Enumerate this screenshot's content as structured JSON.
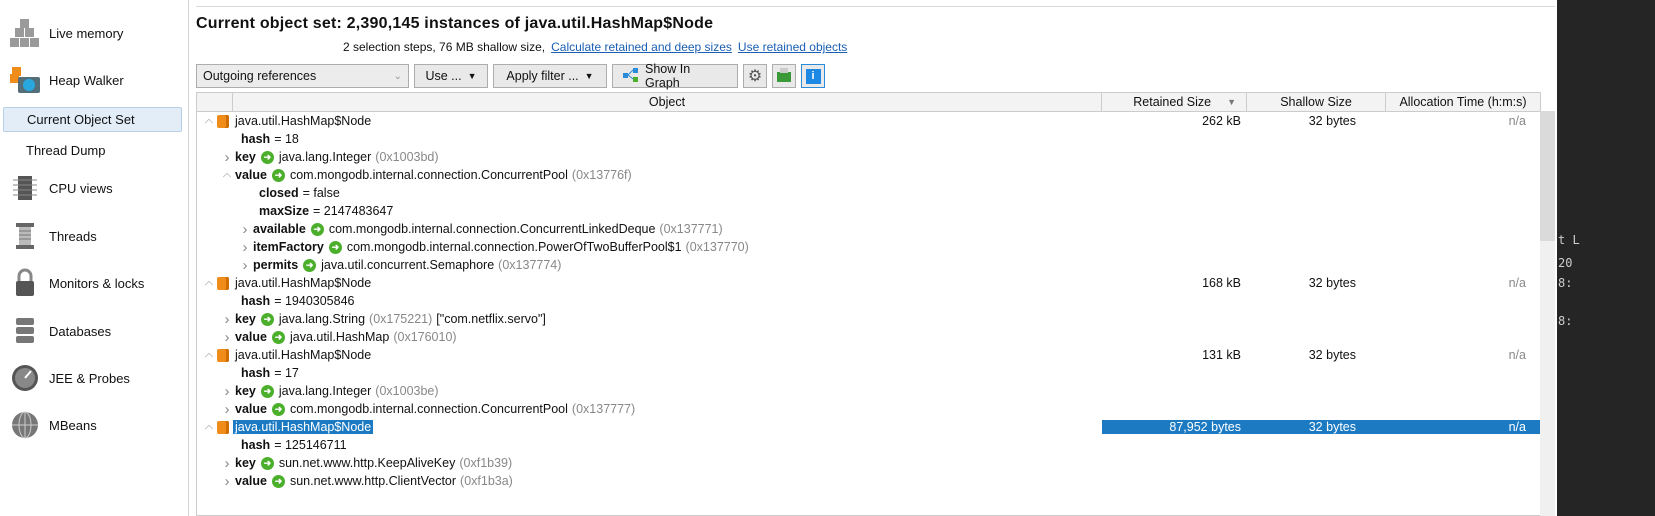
{
  "sidebar": {
    "items": [
      {
        "label": "Live memory",
        "icon": "live-memory-icon"
      },
      {
        "label": "Heap Walker",
        "icon": "heap-walker-icon"
      },
      {
        "label": "CPU views",
        "icon": "cpu-icon"
      },
      {
        "label": "Threads",
        "icon": "threads-icon"
      },
      {
        "label": "Monitors & locks",
        "icon": "lock-icon"
      },
      {
        "label": "Databases",
        "icon": "database-icon"
      },
      {
        "label": "JEE & Probes",
        "icon": "gauge-icon"
      },
      {
        "label": "MBeans",
        "icon": "globe-icon"
      }
    ],
    "subitems": [
      {
        "label": "Current Object Set",
        "selected": true
      },
      {
        "label": "Thread Dump",
        "selected": false
      }
    ]
  },
  "header": {
    "title": "Current object set:  2,390,145 instances of java.util.HashMap$Node",
    "summary": "2 selection steps, 76 MB shallow size,",
    "link_retained": "Calculate retained and deep sizes",
    "link_use_retained": "Use retained objects"
  },
  "toolbar": {
    "view": "Outgoing references",
    "use": "Use ...",
    "filter": "Apply filter ...",
    "graph": "Show In Graph"
  },
  "table": {
    "columns": [
      "Object",
      "Retained Size",
      "Shallow Size",
      "Allocation Time (h:m:s)"
    ],
    "sort_column": "Retained Size",
    "rows": [
      {
        "level": 0,
        "toggle": "open",
        "type": "node",
        "text": "java.util.HashMap$Node",
        "retained": "262 kB",
        "shallow": "32 bytes",
        "alloc": "n/a"
      },
      {
        "level": 1,
        "toggle": "none",
        "type": "field",
        "name": "hash",
        "value": "= 18"
      },
      {
        "level": 1,
        "toggle": "closed",
        "type": "ref",
        "name": "key",
        "text": "java.lang.Integer",
        "addr": "(0x1003bd)"
      },
      {
        "level": 1,
        "toggle": "open",
        "type": "ref",
        "name": "value",
        "text": "com.mongodb.internal.connection.ConcurrentPool",
        "addr": "(0x13776f)"
      },
      {
        "level": 2,
        "toggle": "none",
        "type": "field",
        "name": "closed",
        "value": "= false"
      },
      {
        "level": 2,
        "toggle": "none",
        "type": "field",
        "name": "maxSize",
        "value": "= 2147483647"
      },
      {
        "level": 2,
        "toggle": "closed",
        "type": "ref",
        "name": "available",
        "text": "com.mongodb.internal.connection.ConcurrentLinkedDeque",
        "addr": "(0x137771)"
      },
      {
        "level": 2,
        "toggle": "closed",
        "type": "ref",
        "name": "itemFactory",
        "text": "com.mongodb.internal.connection.PowerOfTwoBufferPool$1",
        "addr": "(0x137770)"
      },
      {
        "level": 2,
        "toggle": "closed",
        "type": "ref",
        "name": "permits",
        "text": "java.util.concurrent.Semaphore",
        "addr": "(0x137774)"
      },
      {
        "level": 0,
        "toggle": "open",
        "type": "node",
        "text": "java.util.HashMap$Node",
        "retained": "168 kB",
        "shallow": "32 bytes",
        "alloc": "n/a"
      },
      {
        "level": 1,
        "toggle": "none",
        "type": "field",
        "name": "hash",
        "value": "= 1940305846"
      },
      {
        "level": 1,
        "toggle": "closed",
        "type": "ref",
        "name": "key",
        "text": "java.lang.String",
        "addr": "(0x175221)",
        "extra": "[\"com.netflix.servo\"]"
      },
      {
        "level": 1,
        "toggle": "closed",
        "type": "ref",
        "name": "value",
        "text": "java.util.HashMap",
        "addr": "(0x176010)"
      },
      {
        "level": 0,
        "toggle": "open",
        "type": "node",
        "text": "java.util.HashMap$Node",
        "retained": "131 kB",
        "shallow": "32 bytes",
        "alloc": "n/a"
      },
      {
        "level": 1,
        "toggle": "none",
        "type": "field",
        "name": "hash",
        "value": "= 17"
      },
      {
        "level": 1,
        "toggle": "closed",
        "type": "ref",
        "name": "key",
        "text": "java.lang.Integer",
        "addr": "(0x1003be)"
      },
      {
        "level": 1,
        "toggle": "closed",
        "type": "ref",
        "name": "value",
        "text": "com.mongodb.internal.connection.ConcurrentPool",
        "addr": "(0x137777)"
      },
      {
        "level": 0,
        "toggle": "open",
        "type": "node",
        "text": "java.util.HashMap$Node",
        "retained": "87,952 bytes",
        "shallow": "32 bytes",
        "alloc": "n/a",
        "selected": true
      },
      {
        "level": 1,
        "toggle": "none",
        "type": "field",
        "name": "hash",
        "value": "= 125146711"
      },
      {
        "level": 1,
        "toggle": "closed",
        "type": "ref",
        "name": "key",
        "text": "sun.net.www.http.KeepAliveKey",
        "addr": "(0xf1b39)"
      },
      {
        "level": 1,
        "toggle": "closed",
        "type": "ref",
        "name": "value",
        "text": "sun.net.www.http.ClientVector",
        "addr": "(0xf1b3a)"
      }
    ]
  },
  "background_window": {
    "lines": [
      "t L",
      "20",
      "8:",
      "8:"
    ]
  },
  "colors": {
    "selection": "#1c7ac3",
    "link": "#1a5fb4",
    "node_icon": "#f08c1a",
    "ref_icon": "#4caf2c"
  }
}
